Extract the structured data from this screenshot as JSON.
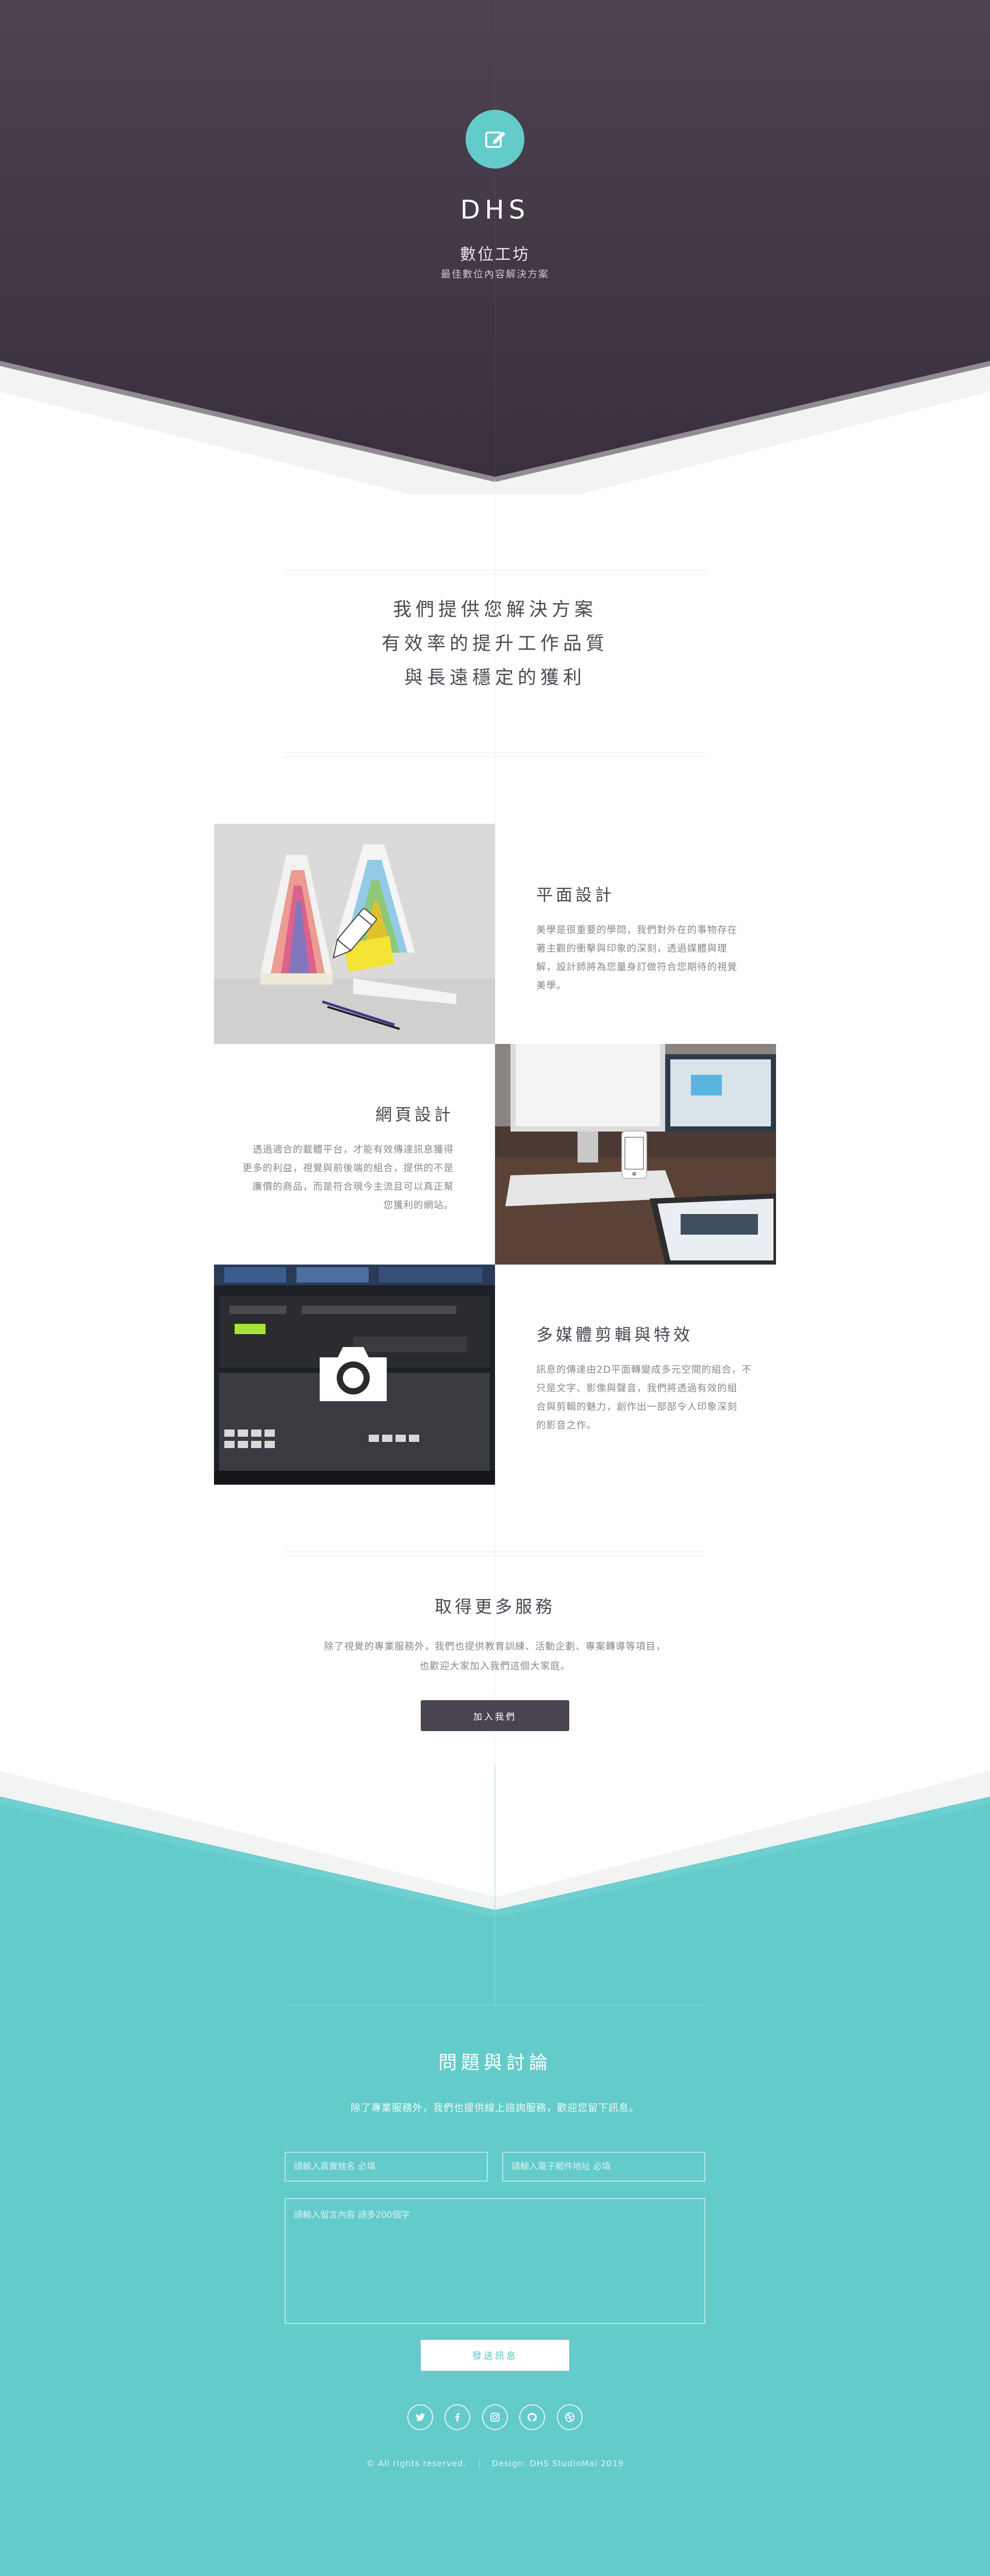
{
  "header": {
    "brand": "DHS",
    "subtitle": "數位工坊",
    "tagline": "最佳數位內容解決方案",
    "logo_icon": "edit-icon"
  },
  "intro": {
    "lines": [
      "我們提供您解決方案",
      "有效率的提升工作品質",
      "與長遠穩定的獲利"
    ]
  },
  "services": [
    {
      "title": "平面設計",
      "lines": [
        "美學是很重要的學問，我們對外在的事物存在",
        "著主觀的衝擊與印象的深刻，透過媒體與理",
        "解，設計師將為您量身訂做符合您期待的視覺",
        "美學。"
      ],
      "icon": "pencil-icon"
    },
    {
      "title": "網頁設計",
      "lines": [
        "透過適合的載體平台，才能有效傳達訊息獲得",
        "更多的利益，視覺與前後端的組合，提供的不是",
        "廉價的商品，而是符合現今主流且可以真正幫",
        "您獲利的網站。"
      ],
      "icon": "mobile-icon"
    },
    {
      "title": "多媒體剪輯與特效",
      "lines": [
        "訊息的傳達由2D平面轉變成多元空間的組合，不",
        "只是文字、影像與聲音，我們將透過有效的組",
        "合與剪輯的魅力，創作出一部部令人印象深刻",
        "的影音之作。"
      ],
      "icon": "camera-icon"
    }
  ],
  "more": {
    "title": "取得更多服務",
    "lines": [
      "除了視覺的專業服務外，我們也提供教育訓練、活動企劃、專案轉導等項目，",
      "也歡迎大家加入我們這個大家庭。"
    ],
    "button": "加入我們"
  },
  "contact": {
    "title": "問題與討論",
    "description": "除了專業服務外，我們也提供線上諮詢服務，歡迎您留下訊息。",
    "name_placeholder": "請輸入真實姓名 必填",
    "email_placeholder": "請輸入電子郵件地址 必填",
    "message_placeholder": "請輸入留言內容 請多200個字",
    "send_button": "發送訊息"
  },
  "social": [
    "twitter-icon",
    "facebook-icon",
    "instagram-icon",
    "github-icon",
    "dribbble-icon"
  ],
  "footer": {
    "rights": "© All rights reserved.",
    "credit": "Design: DHS StudioMai 2019"
  },
  "colors": {
    "hero_dark": "#413643",
    "accent": "#64cbcb",
    "button_dark": "#4a4450"
  }
}
